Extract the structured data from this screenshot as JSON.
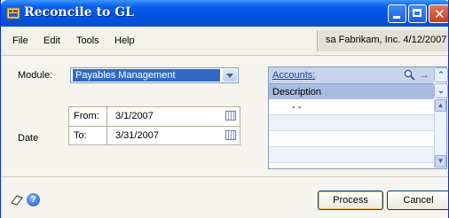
{
  "window": {
    "title": "Reconcile to GL"
  },
  "menu": {
    "items": [
      "File",
      "Edit",
      "Tools",
      "Help"
    ]
  },
  "company_info": "sa  Fabrikam, Inc.  4/12/2007",
  "form": {
    "module_label": "Module:",
    "module_value": "Payables Management",
    "date_label": "Date",
    "from_label": "From:",
    "from_value": "3/1/2007",
    "to_label": "To:",
    "to_value": "3/31/2007"
  },
  "accounts": {
    "link_label": "Accounts:",
    "column_header": "Description",
    "rows": [
      "-      -",
      "",
      "",
      "",
      ""
    ]
  },
  "buttons": {
    "process": "Process",
    "cancel": "Cancel"
  },
  "colors": {
    "titlebar": "#0053e1",
    "selection": "#316ac5",
    "link": "#1b3fbf"
  }
}
